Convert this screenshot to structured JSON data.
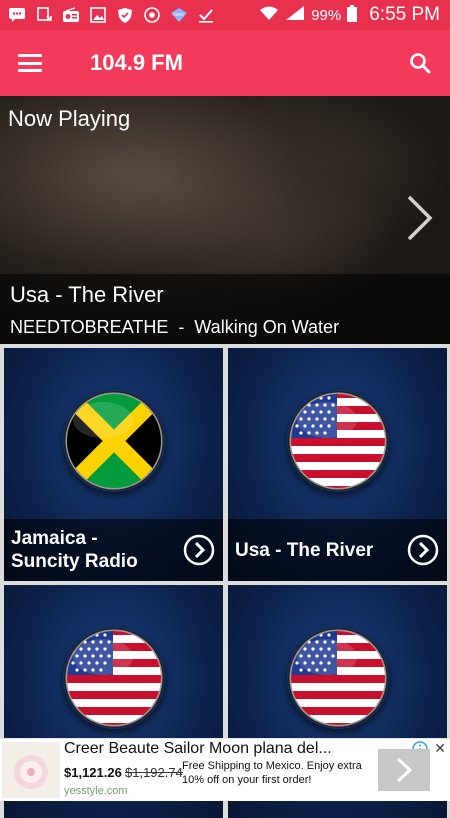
{
  "status_bar": {
    "battery": "99%",
    "time": "6:55 PM",
    "icons": [
      "chat-icon",
      "download-icon",
      "radio-icon",
      "image-icon",
      "shield-icon",
      "chrome-icon",
      "badge-icon",
      "check-icon",
      "wifi-icon",
      "signal-icon",
      "battery-icon"
    ]
  },
  "appbar": {
    "title": "104.9 FM",
    "menu_icon": "menu-icon",
    "search_icon": "search-icon"
  },
  "now_playing": {
    "label": "Now Playing",
    "station": "Usa - The River",
    "track": "NEEDTOBREATHE  -  Walking On Water",
    "next_icon": "chevron-right-icon"
  },
  "stations": [
    {
      "title": "Jamaica - Suncity Radio",
      "flag": "jamaica"
    },
    {
      "title": "Usa - The River",
      "flag": "usa"
    },
    {
      "title": "",
      "flag": "usa"
    },
    {
      "title": "",
      "flag": "usa"
    }
  ],
  "ad": {
    "title": "Creer Beaute Sailor Moon plana del...",
    "price": "$1,121.26",
    "old_price": "$1,192.74",
    "description": "Free Shipping to Mexico. Enjoy extra 10% off on your first order!",
    "domain": "yesstyle.com",
    "close": "✕"
  },
  "colors": {
    "status_bar": "#e8304f",
    "app_bar": "#f33a5a",
    "card_blue": "#0d2450"
  }
}
